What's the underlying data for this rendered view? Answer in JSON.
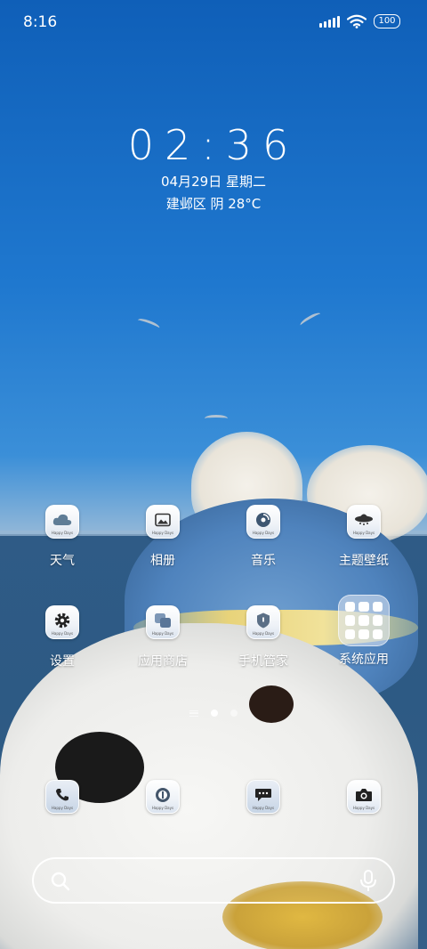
{
  "status_bar": {
    "time": "8:16",
    "battery": "100",
    "icons": [
      "signal-icon",
      "wifi-icon",
      "battery-icon"
    ]
  },
  "widget": {
    "clock": "02:36",
    "date": "04月29日 星期二",
    "weather": "建邺区 阴 28°C"
  },
  "apps_row1": [
    {
      "label": "天气",
      "icon": "cloud-icon"
    },
    {
      "label": "相册",
      "icon": "gallery-icon"
    },
    {
      "label": "音乐",
      "icon": "music-icon"
    },
    {
      "label": "主题壁纸",
      "icon": "themes-icon"
    }
  ],
  "apps_row2": [
    {
      "label": "设置",
      "icon": "gear-icon"
    },
    {
      "label": "应用商店",
      "icon": "app-store-icon"
    },
    {
      "label": "手机管家",
      "icon": "security-icon"
    },
    {
      "label": "系统应用",
      "icon": "folder-icon"
    }
  ],
  "dock": [
    {
      "icon": "phone-icon"
    },
    {
      "icon": "browser-icon"
    },
    {
      "icon": "messages-icon"
    },
    {
      "icon": "camera-icon"
    }
  ],
  "page_indicator": {
    "pages": 2,
    "current": 1
  },
  "search_bar": {
    "icons": [
      "search-icon",
      "microphone-icon"
    ]
  },
  "icon_tag_text": "Happy Days"
}
